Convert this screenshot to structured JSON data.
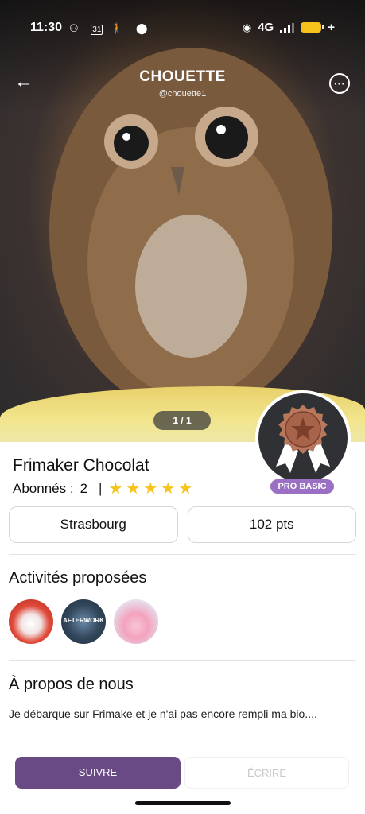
{
  "status_bar": {
    "time": "11:30",
    "left_icons": [
      "charge-icon",
      "calendar-icon",
      "walk-icon",
      "location-icon"
    ],
    "calendar_day": "31",
    "network": "4G"
  },
  "header": {
    "title": "CHOUETTE",
    "handle": "@chouette1",
    "back_icon": "arrow-left-icon",
    "more_icon": "more-icon"
  },
  "gallery": {
    "pager": "1 / 1"
  },
  "profile": {
    "name": "Frimaker Chocolat",
    "followers_label": "Abonnés :",
    "followers_count": "2",
    "rating": 5,
    "badge_label": "PRO BASIC",
    "city": "Strasbourg",
    "points": "102 pts"
  },
  "activities": {
    "title": "Activités proposées",
    "items": [
      {
        "name": "bowling",
        "label": ""
      },
      {
        "name": "afterwork",
        "label": "AFTERWORK"
      },
      {
        "name": "cocktail",
        "label": ""
      }
    ]
  },
  "about": {
    "title": "À propos de nous",
    "text": "Je débarque sur Frimake et je n'ai pas encore rempli ma bio...."
  },
  "actions": {
    "follow": "SUIVRE",
    "write": "ÉCRIRE"
  },
  "colors": {
    "accent": "#6a4a84",
    "badge": "#9a6fc4",
    "star": "#f6c31a"
  }
}
